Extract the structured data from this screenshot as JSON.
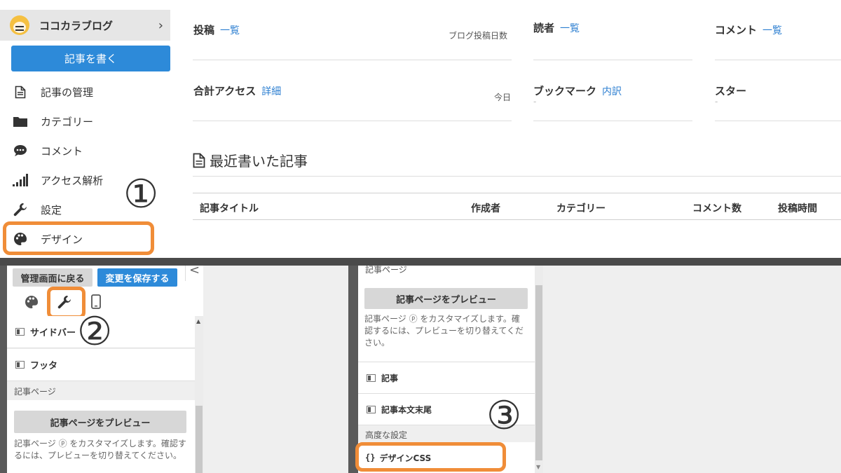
{
  "top": {
    "blog_name": "ココカラブログ",
    "write_button": "記事を書く",
    "nav": [
      {
        "label": "記事の管理",
        "icon": "document-icon"
      },
      {
        "label": "カテゴリー",
        "icon": "folder-icon"
      },
      {
        "label": "コメント",
        "icon": "comment-icon"
      },
      {
        "label": "アクセス解析",
        "icon": "signal-bars-icon"
      },
      {
        "label": "設定",
        "icon": "wrench-icon"
      },
      {
        "label": "デザイン",
        "icon": "palette-icon"
      }
    ],
    "annotation_1": "①",
    "stats": {
      "posts_title": "投稿",
      "posts_link": "一覧",
      "posts_sub": "ブログ投稿日数",
      "readers_title": "読者",
      "readers_link": "一覧",
      "comments_title": "コメント",
      "comments_link": "一覧",
      "access_title": "合計アクセス",
      "access_link": "詳細",
      "access_sub": "今日",
      "bookmark_title": "ブックマーク",
      "bookmark_link": "内訳",
      "bookmark_value": "-",
      "star_title": "スター",
      "star_value": "-"
    },
    "recent_title": "最近書いた記事",
    "table_headers": [
      "記事タイトル",
      "作成者",
      "カテゴリー",
      "コメント数",
      "投稿時間"
    ]
  },
  "bottom_left": {
    "back_button": "管理画面に戻る",
    "save_button": "変更を保存する",
    "collapse_glyph": "<",
    "annotation_2": "②",
    "items": [
      "サイドバー",
      "フッタ"
    ],
    "section_label": "記事ページ",
    "preview_button": "記事ページをプレビュー",
    "help_text": "記事ページ ⓟ をカスタマイズします。確認するには、プレビューを切り替えてください。"
  },
  "bottom_right": {
    "section_label_top": "記事ページ",
    "preview_button": "記事ページをプレビュー",
    "help_text": "記事ページ ⓟ をカスタマイズします。確認するには、プレビューを切り替えてください。",
    "items": [
      "記事",
      "記事本文末尾"
    ],
    "advanced_label": "高度な設定",
    "css_item": "デザインCSS",
    "css_glyph": "{}",
    "annotation_3": "③"
  },
  "colors": {
    "accent_blue": "#2d8ad9",
    "link_blue": "#2d7fd1",
    "highlight_orange": "#f08d38"
  }
}
